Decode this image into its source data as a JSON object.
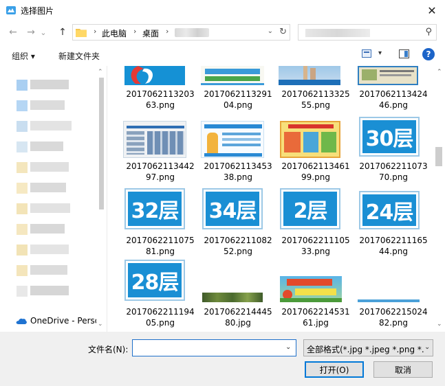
{
  "window": {
    "title": "选择图片",
    "close_glyph": "✕"
  },
  "nav": {
    "back": "←",
    "forward": "→",
    "dropdown": "⌄",
    "up": "↑"
  },
  "address": {
    "crumbs": [
      "此电脑",
      "桌面"
    ],
    "separator": "›",
    "dropdown_glyph": "⌄",
    "refresh_glyph": "↻"
  },
  "search": {
    "icon_glyph": "⚲"
  },
  "toolbar": {
    "organize": "组织 ▾",
    "new_folder": "新建文件夹",
    "view_dropdown": "▾",
    "help": "?"
  },
  "sidebar": {
    "onedrive_label": "OneDrive - Personal",
    "scroll_up": "⌃",
    "scroll_down": "⌄"
  },
  "files": [
    {
      "name": "2017062113203 63.png",
      "kind": "logo"
    },
    {
      "name": "2017062113291 04.png",
      "kind": "banner-a"
    },
    {
      "name": "2017062113325 55.png",
      "kind": "banner-b"
    },
    {
      "name": "2017062113424 46.png",
      "kind": "banner-c"
    },
    {
      "name": "2017062113442 97.png",
      "kind": "board-a"
    },
    {
      "name": "2017062113453 38.png",
      "kind": "board-b"
    },
    {
      "name": "2017062113461 99.png",
      "kind": "board-c"
    },
    {
      "name": "2017062211073 70.png",
      "kind": "floor",
      "sign": "30层"
    },
    {
      "name": "2017062211075 81.png",
      "kind": "floor",
      "sign": "32层"
    },
    {
      "name": "2017062211082 52.png",
      "kind": "floor",
      "sign": "34层"
    },
    {
      "name": "2017062211105 33.png",
      "kind": "floor",
      "sign": "2层"
    },
    {
      "name": "2017062211165 44.png",
      "kind": "floor",
      "sign": "24层"
    },
    {
      "name": "2017062211194 05.png",
      "kind": "floor",
      "sign": "28层"
    },
    {
      "name": "2017062214445 80.jpg",
      "kind": "forest"
    },
    {
      "name": "2017062214531 61.jpg",
      "kind": "green-banner"
    },
    {
      "name": "2017062215024 82.png",
      "kind": "thin-strip"
    }
  ],
  "content_scroll": {
    "up": "⌃",
    "down": "⌄"
  },
  "bottom": {
    "filename_label": "文件名(N):",
    "filename_value": "",
    "filename_dropdown": "⌄",
    "filter": "全部格式(*.jpg *.jpeg *.png *.",
    "filter_dropdown": "⌄",
    "open": "打开(O)",
    "cancel": "取消"
  },
  "colors": {
    "accent": "#0078d7",
    "sign_blue": "#1a8fd4",
    "help_blue": "#1c64c8"
  }
}
